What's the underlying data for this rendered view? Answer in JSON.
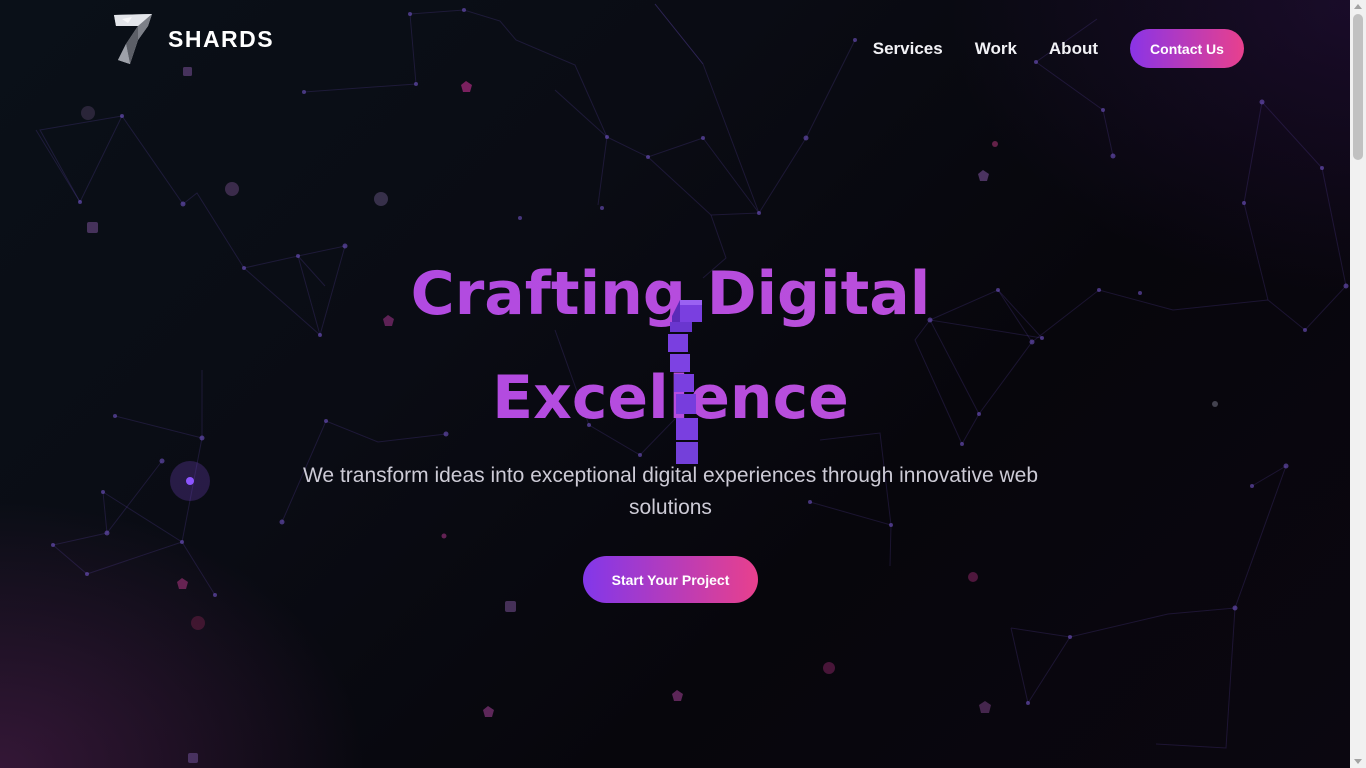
{
  "brand": {
    "name": "SHARDS",
    "logo_icon": "seven-shard-icon"
  },
  "nav": {
    "items": [
      {
        "label": "Services"
      },
      {
        "label": "Work"
      },
      {
        "label": "About"
      }
    ],
    "contact_label": "Contact Us"
  },
  "hero": {
    "title_line1": "Crafting Digital",
    "title_line2": "Excellence",
    "subtitle": "We transform ideas into exceptional digital experiences through innovative web solutions",
    "cta_label": "Start Your Project"
  },
  "colors": {
    "accent_purple": "#8a34e6",
    "accent_pink": "#e8408d",
    "title_purple": "#b64fe1",
    "background": "#07070d"
  },
  "scrollbar": {
    "position": 0
  }
}
